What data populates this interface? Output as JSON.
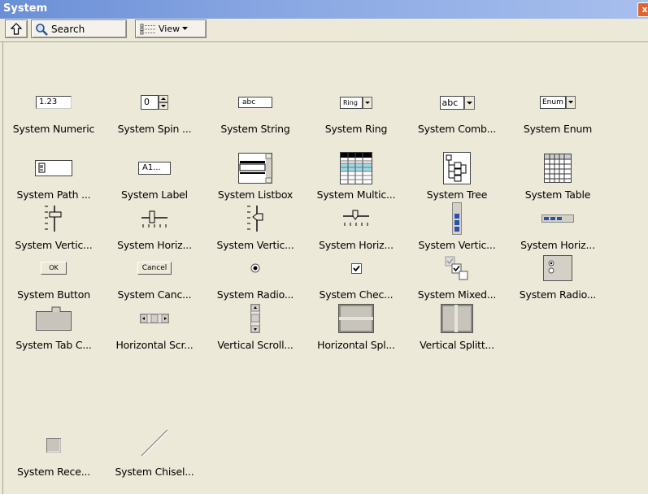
{
  "window": {
    "title": "System",
    "close_glyph": "x"
  },
  "toolbar": {
    "up_icon": "up-arrow-icon",
    "search_label": "Search",
    "view_label": "View"
  },
  "palette": {
    "rows": [
      [
        {
          "label": "System Numeric",
          "icon": "numeric-control-icon",
          "value": "1.23"
        },
        {
          "label": "System Spin ...",
          "icon": "spin-control-icon",
          "value": "0"
        },
        {
          "label": "System String",
          "icon": "string-control-icon",
          "value": "abc"
        },
        {
          "label": "System Ring",
          "icon": "ring-control-icon",
          "value": "Ring"
        },
        {
          "label": "System Comb...",
          "icon": "combo-box-icon",
          "value": "abc"
        },
        {
          "label": "System Enum",
          "icon": "enum-control-icon",
          "value": "Enum"
        }
      ],
      [
        {
          "label": "System Path ...",
          "icon": "path-control-icon"
        },
        {
          "label": "System Label",
          "icon": "label-icon",
          "value": "A1..."
        },
        {
          "label": "System Listbox",
          "icon": "listbox-icon"
        },
        {
          "label": "System Multic...",
          "icon": "multicolumn-listbox-icon"
        },
        {
          "label": "System Tree",
          "icon": "tree-control-icon"
        },
        {
          "label": "System Table",
          "icon": "table-icon"
        }
      ],
      [
        {
          "label": "System Vertic...",
          "icon": "vertical-slide-icon"
        },
        {
          "label": "System Horiz...",
          "icon": "horizontal-slide-icon"
        },
        {
          "label": "System Vertic...",
          "icon": "vertical-pointer-slide-icon"
        },
        {
          "label": "System Horiz...",
          "icon": "horizontal-pointer-slide-icon"
        },
        {
          "label": "System Vertic...",
          "icon": "vertical-progress-bar-icon"
        },
        {
          "label": "System Horiz...",
          "icon": "horizontal-progress-bar-icon"
        }
      ],
      [
        {
          "label": "System Button",
          "icon": "ok-button-icon",
          "value": "OK"
        },
        {
          "label": "System Canc...",
          "icon": "cancel-button-icon",
          "value": "Cancel"
        },
        {
          "label": "System Radio...",
          "icon": "radio-button-icon"
        },
        {
          "label": "System Chec...",
          "icon": "checkbox-icon"
        },
        {
          "label": "System Mixed...",
          "icon": "mixed-checkbox-icon"
        },
        {
          "label": "System Radio...",
          "icon": "radio-buttons-group-icon"
        }
      ],
      [
        {
          "label": "System Tab C...",
          "icon": "tab-control-icon"
        },
        {
          "label": "Horizontal Scr...",
          "icon": "horizontal-scrollbar-icon"
        },
        {
          "label": "Vertical Scroll...",
          "icon": "vertical-scrollbar-icon"
        },
        {
          "label": "Horizontal Spl...",
          "icon": "horizontal-splitter-icon"
        },
        {
          "label": "Vertical Splitt...",
          "icon": "vertical-splitter-icon"
        }
      ],
      [
        {
          "label": "System Rece...",
          "icon": "recessed-box-icon"
        },
        {
          "label": "System Chisel...",
          "icon": "chisel-line-icon"
        }
      ]
    ]
  }
}
